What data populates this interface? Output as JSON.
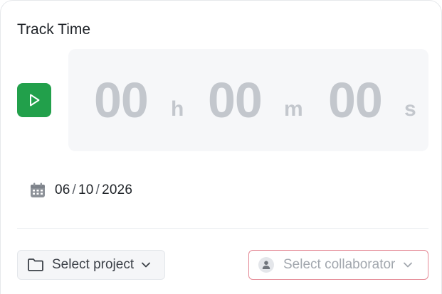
{
  "panel": {
    "title": "Track Time"
  },
  "timer": {
    "hours": "00",
    "hours_unit": "h",
    "minutes": "00",
    "minutes_unit": "m",
    "seconds": "00",
    "seconds_unit": "s"
  },
  "date": {
    "month": "06",
    "day": "10",
    "year": "2026",
    "separator": "/"
  },
  "project_select": {
    "label": "Select project"
  },
  "collaborator_select": {
    "label": "Select collaborator"
  },
  "colors": {
    "play_button": "#22a04b",
    "timer_digits": "#c3c7cd",
    "collaborator_border": "#e58a96"
  },
  "icons": {
    "play": "play-icon",
    "date": "calendar-icon",
    "project": "folder-icon",
    "collaborator": "user-icon",
    "dropdown": "chevron-down-icon"
  }
}
